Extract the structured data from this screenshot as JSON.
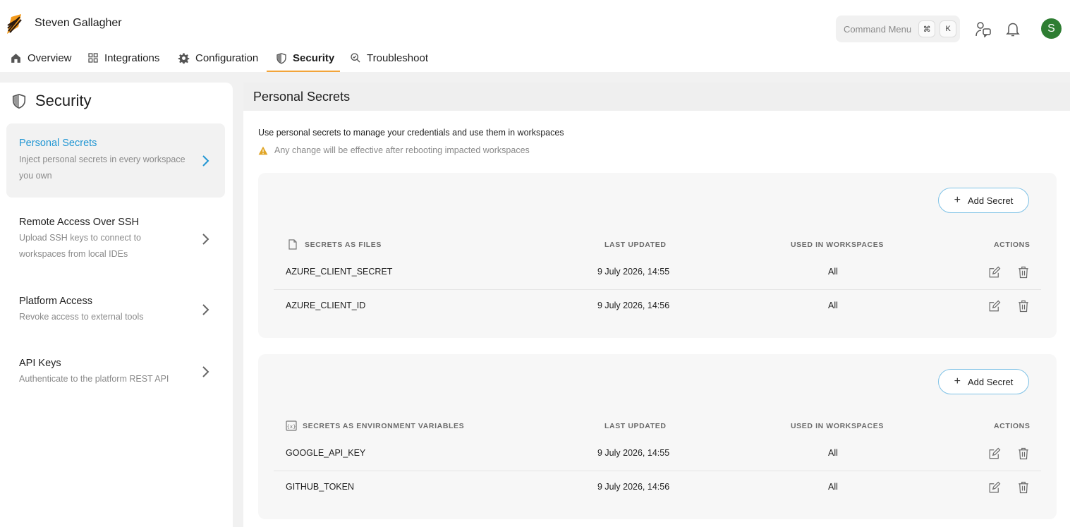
{
  "header": {
    "user_name": "Steven Gallagher",
    "command_menu": {
      "label": "Command Menu",
      "key1": "⌘",
      "key2": "K"
    },
    "avatar_initial": "S"
  },
  "tabs": [
    {
      "label": "Overview",
      "icon": "home-icon"
    },
    {
      "label": "Integrations",
      "icon": "grid-icon"
    },
    {
      "label": "Configuration",
      "icon": "gear-icon"
    },
    {
      "label": "Security",
      "icon": "shield-icon",
      "active": true
    },
    {
      "label": "Troubleshoot",
      "icon": "troubleshoot-icon"
    }
  ],
  "sidebar": {
    "title": "Security",
    "items": [
      {
        "title": "Personal Secrets",
        "desc": "Inject personal secrets in every workspace you own",
        "active": true
      },
      {
        "title": "Remote Access Over SSH",
        "desc": "Upload SSH keys to connect to workspaces from local IDEs"
      },
      {
        "title": "Platform Access",
        "desc": "Revoke access to external tools"
      },
      {
        "title": "API Keys",
        "desc": "Authenticate to the platform REST API"
      }
    ]
  },
  "main": {
    "title": "Personal Secrets",
    "intro": "Use personal secrets to manage your credentials and use them in workspaces",
    "warning": "Any change will be effective after rebooting impacted workspaces",
    "add_label": "Add Secret",
    "columns": {
      "updated": "LAST UPDATED",
      "used": "USED IN WORKSPACES",
      "actions": "ACTIONS"
    },
    "file_secrets": {
      "header": "SECRETS AS FILES",
      "rows": [
        {
          "name": "AZURE_CLIENT_SECRET",
          "updated": "9 July 2026, 14:55",
          "used": "All"
        },
        {
          "name": "AZURE_CLIENT_ID",
          "updated": "9 July 2026, 14:56",
          "used": "All"
        }
      ]
    },
    "env_secrets": {
      "header": "SECRETS AS ENVIRONMENT VARIABLES",
      "rows": [
        {
          "name": "GOOGLE_API_KEY",
          "updated": "9 July 2026, 14:55",
          "used": "All"
        },
        {
          "name": "GITHUB_TOKEN",
          "updated": "9 July 2026, 14:56",
          "used": "All"
        }
      ]
    }
  },
  "colors": {
    "accent": "#2196d3",
    "tab_underline": "#f2a43a",
    "warning": "#e0a526",
    "avatar": "#2e7d32"
  }
}
